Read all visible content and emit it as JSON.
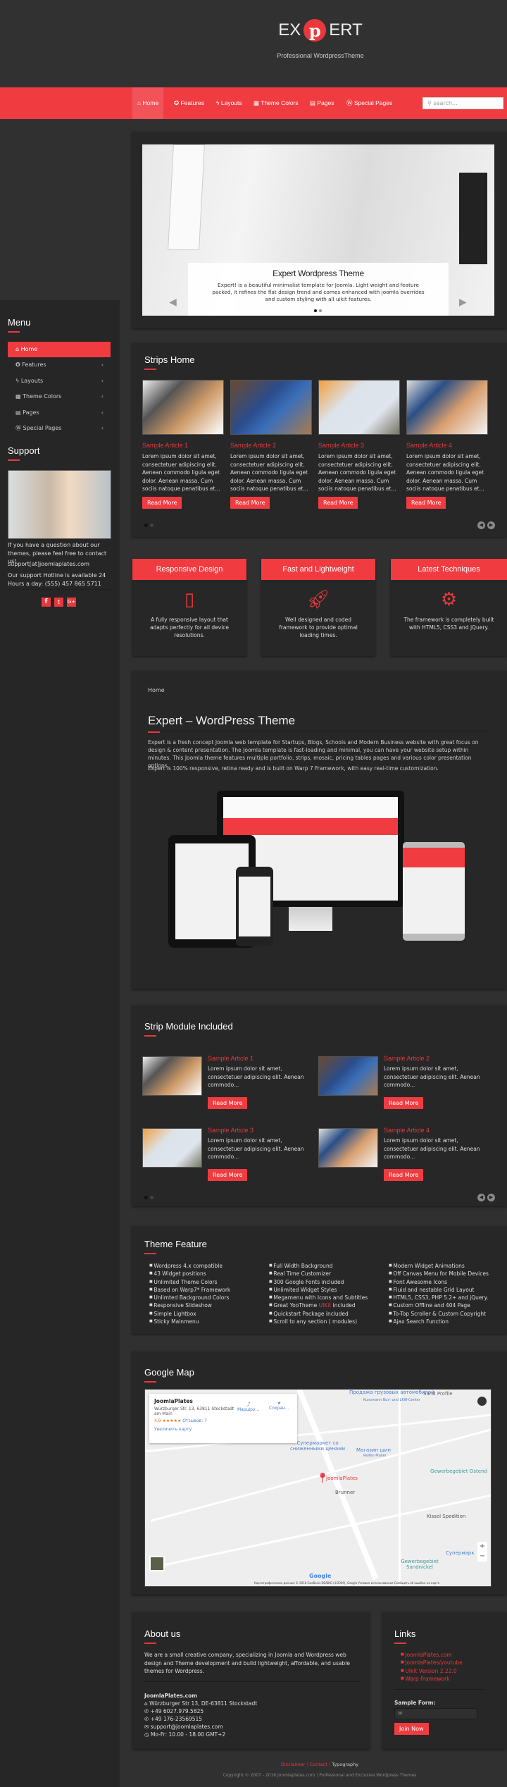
{
  "header": {
    "logo_left": "EX",
    "logo_right": "ERT",
    "logo_mark": "p",
    "tagline": "Professional WordpressTheme"
  },
  "nav": {
    "items": [
      {
        "label": "Home",
        "icon": "home-icon"
      },
      {
        "label": "Features",
        "icon": "gear-icon"
      },
      {
        "label": "Layouts",
        "icon": "bolt-icon"
      },
      {
        "label": "Theme Colors",
        "icon": "table-icon"
      },
      {
        "label": "Pages",
        "icon": "list-icon"
      },
      {
        "label": "Special Pages",
        "icon": "wordpress-icon"
      }
    ],
    "search_placeholder": "search..."
  },
  "colors": {
    "accent": "#f03c41",
    "background": "#303030",
    "panel": "#272727"
  },
  "slider": {
    "title": "Expert Wordpress Theme",
    "text": "Expert! is a beautiful minimalist template for Joomla. Light weight and feature packed, it refines the flat design trend and comes enhanced with joomla overrides and custom styling with all uikit features.",
    "slides": 2,
    "active": 1
  },
  "sidebar": {
    "menu_title": "Menu",
    "items": [
      {
        "label": "Home",
        "icon": "home-icon"
      },
      {
        "label": "Features",
        "icon": "gear-icon"
      },
      {
        "label": "Layouts",
        "icon": "bolt-icon"
      },
      {
        "label": "Theme Colors",
        "icon": "table-icon"
      },
      {
        "label": "Pages",
        "icon": "list-icon"
      },
      {
        "label": "Special Pages",
        "icon": "wordpress-icon"
      }
    ],
    "support_title": "Support",
    "support_text": "If you have a question about our themes, please feel free to contact us!",
    "support_email": "support[at]joomlaplates.com",
    "hotline": "Our support Hotline is available 24 Hours a day: (555) 457 865 5711",
    "social": [
      "facebook-icon",
      "twitter-icon",
      "google-plus-icon"
    ]
  },
  "strips": {
    "title": "Strips Home",
    "articles": [
      {
        "title": "Sample Article 1",
        "text": "Lorem ipsum dolor sit amet, consectetuer adipiscing elit. Aenean commodo ligula eget dolor. Aenean massa. Cum sociis natoque penatibus et...",
        "button": "Read More"
      },
      {
        "title": "Sample Article 2",
        "text": "Lorem ipsum dolor sit amet, consectetuer adipiscing elit. Aenean commodo ligula eget dolor. Aenean massa. Cum sociis natoque penatibus et...",
        "button": "Read More"
      },
      {
        "title": "Sample Article 3",
        "text": "Lorem ipsum dolor sit amet, consectetuer adipiscing elit. Aenean commodo ligula eget dolor. Aenean massa. Cum sociis natoque penatibus et...",
        "button": "Read More"
      },
      {
        "title": "Sample Article 4",
        "text": "Lorem ipsum dolor sit amet, consectetuer adipiscing elit. Aenean commodo ligula eget dolor. Aenean massa. Cum sociis natoque penatibus et...",
        "button": "Read More"
      }
    ]
  },
  "features": [
    {
      "title": "Responsive Design",
      "icon": "mobile-phone-icon",
      "text": "A fully responsive layout that adapts perfectly for all device resolutions."
    },
    {
      "title": "Fast and Lightweight",
      "icon": "rocket-icon",
      "text": "Well designed and coded framework to provide optimal loading times."
    },
    {
      "title": "Latest Techniques",
      "icon": "gears-icon",
      "text": "The framework is completely built with HTML5, CSS3 and jQuery."
    }
  ],
  "main": {
    "breadcrumb": "Home",
    "title": "Expert – WordPress Theme",
    "para1": "Expert is a fresh concept Joomla web template for Startups, Blogs, Schools and Modern Business website with great focus on design & content presentation. The Joomla template is fast-loading and minimal, you can have your website setup within minutes. This Joomla theme features multiple portfolio, strips, mosaic, pricing tables pages and various color presentation options.",
    "para2": "Expert is 100% responsive, retina ready and is built on Warp 7 Framework, with easy real-time customization."
  },
  "strip_module": {
    "title": "Strip Module Included",
    "articles": [
      {
        "title": "Sample Article 1",
        "text": "Lorem ipsum dolor sit amet, consectetuer adipiscing elit. Aenean commodo...",
        "button": "Read More"
      },
      {
        "title": "Sample Article 2",
        "text": "Lorem ipsum dolor sit amet, consectetuer adipiscing elit. Aenean commodo...",
        "button": "Read More"
      },
      {
        "title": "Sample Article 3",
        "text": "Lorem ipsum dolor sit amet, consectetuer adipiscing elit. Aenean commodo...",
        "button": "Read More"
      },
      {
        "title": "Sample Article 4",
        "text": "Lorem ipsum dolor sit amet, consectetuer adipiscing elit. Aenean commodo...",
        "button": "Read More"
      }
    ]
  },
  "theme_feature": {
    "title": "Theme Feature",
    "col1": [
      "Wordpress 4.x compatible",
      "43 Widget positions",
      "Unlimited Theme Colors",
      "Based on Warp7* Framework",
      "Unlimted Background Colors",
      "Responsive Slideshow",
      "Simple Lightbox",
      "Sticky Mainmenu"
    ],
    "col2": [
      "Full Width Background",
      "Real Time Customizer",
      "300 Google Fonts included",
      "Unlimited Widget Styles",
      "Megamenu with Icons and Subtitles",
      "Great YooTheme",
      "Quickstart Package included",
      "Scroll to any section ( modules)"
    ],
    "uikit_word": "UIKit",
    "uikit_suffix": "included",
    "col3": [
      "Modern Widget Animations",
      "Off Canvas Menu for Mobile Devices",
      "Font Awesome Icons",
      "Fluid and nestable Grid Layout",
      "HTML5, CSS3, PHP 5.2+ and jQuery.",
      "Custom Offline and 404 Page",
      "To-Top Scroller & Custom Copyright",
      "Ajax Search Function"
    ]
  },
  "map": {
    "title": "Google Map",
    "place": "JoomlaPlates",
    "address": "Würzburger Str. 13, 63811 Stockstadt am Main",
    "rating": "4,9 ★★★★★",
    "reviews": "Отзывов: 7",
    "enlarge": "Увеличить карту",
    "directions": "Маршру...",
    "save": "Сохран...",
    "labels": [
      "Продажа грузовых автомобилей",
      "Kunzmann Bus- und LKW-Center",
      "Sand Profile",
      "Супермаркет со сниженными ценами",
      "Магазин шин",
      "Reifen Müller",
      "Gewerbegebiet Ostend",
      "Brunner",
      "Kissel Spedition",
      "Gewerbegebiet Sandnickel",
      "Супермарк"
    ],
    "marker_label": "JoomlaPlates",
    "google": "Google",
    "attribution": "Картографические данные © 2018 GeoBasis-DE/BKG (©2009), Google   Условия использования   Сообщить об ошибке на карте"
  },
  "about": {
    "title": "About us",
    "text": "We are a small creative company, specializing in Joomla and Wordpress web design and Theme development and build lightweight, affordable, and usable themes for Wordpress.",
    "company": "JoomlaPlates.com",
    "address": "Würzburger Str 13, DE-63811 Stockstadt",
    "phone1": "+49 6027.979.5825",
    "phone2": "+49 176-23569515",
    "email": "support@joomlaplates.com",
    "hours": "Mo-Fr: 10.00 - 18.00 GMT+2"
  },
  "links": {
    "title": "Links",
    "items": [
      "JoomlaPlates.com",
      "JoomlaPlates/youtube",
      "UIkit Version 2.22.0",
      "Warp Framework"
    ],
    "form_label": "Sample Form:",
    "button": "Join Now"
  },
  "footer": {
    "links": [
      "Disclaimer",
      "Contact",
      "Typography"
    ],
    "copyright": "Copyright © 2007 - 2016 Joomlaplates.com | Professional and Exclusive Wordpress Themes"
  }
}
